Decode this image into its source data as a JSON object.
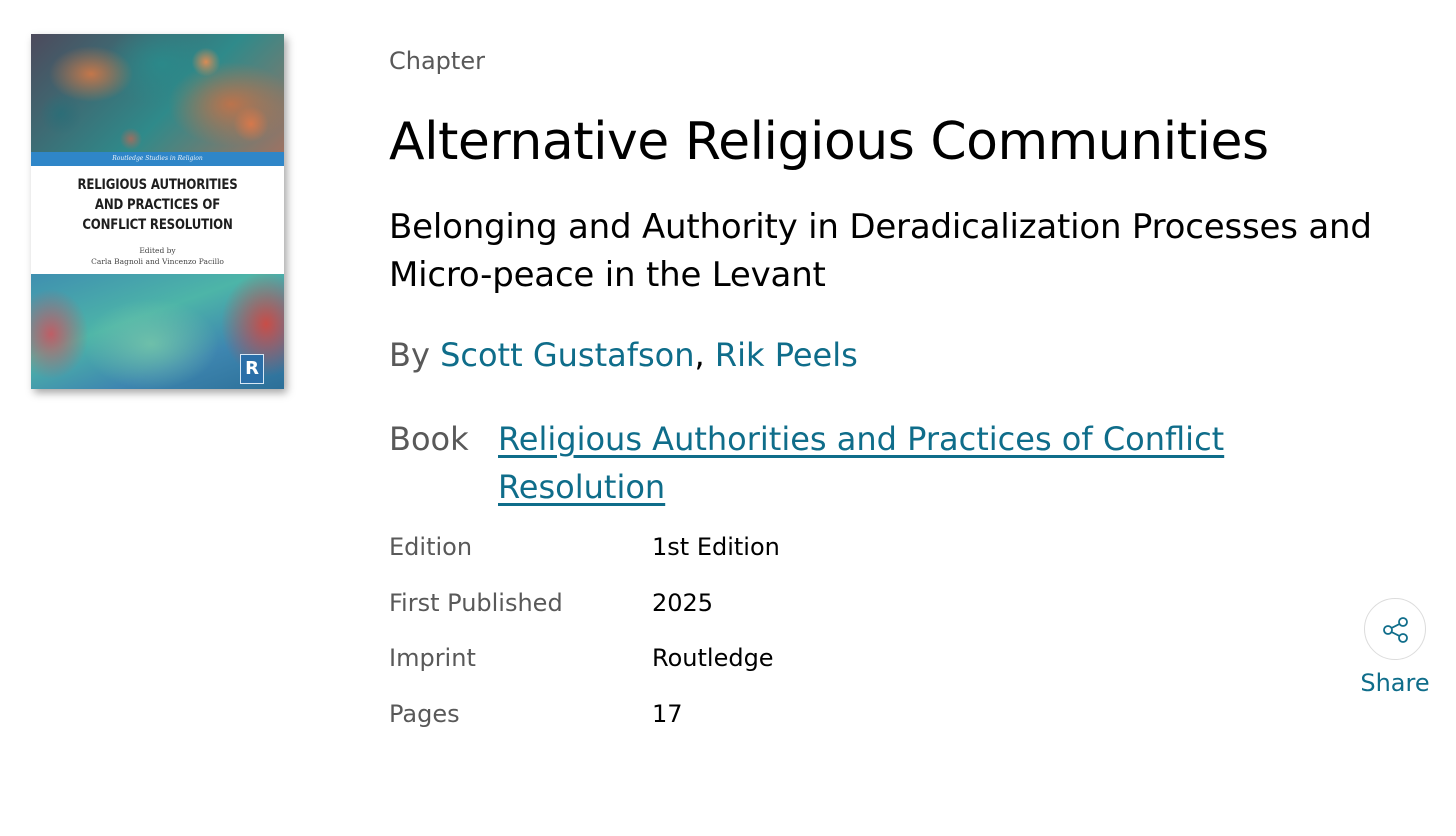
{
  "cover": {
    "series": "Routledge Studies in Religion",
    "title_lines": [
      "RELIGIOUS AUTHORITIES",
      "AND PRACTICES OF",
      "CONFLICT RESOLUTION"
    ],
    "editors_lines": [
      "Edited by",
      "Carla Bagnoli and Vincenzo Pacillo"
    ],
    "publisher_logo": "R"
  },
  "header": {
    "type_label": "Chapter",
    "title": "Alternative Religious Communities",
    "subtitle": "Belonging and Authority in Deradicalization Processes and Micro-peace in the Levant"
  },
  "byline": {
    "prefix": "By ",
    "authors": [
      "Scott Gustafson",
      "Rik Peels"
    ],
    "separator": ", "
  },
  "book": {
    "label": "Book",
    "title": "Religious Authorities and Practices of Conflict Resolution"
  },
  "meta": [
    {
      "key": "Edition",
      "value": "1st Edition"
    },
    {
      "key": "First Published",
      "value": "2025"
    },
    {
      "key": "Imprint",
      "value": "Routledge"
    },
    {
      "key": "Pages",
      "value": "17"
    }
  ],
  "share": {
    "label": "Share",
    "icon": "share-icon"
  },
  "colors": {
    "link": "#0f6d8a",
    "muted_text": "#595959",
    "text": "#000000",
    "cover_band": "#2f86c8"
  }
}
